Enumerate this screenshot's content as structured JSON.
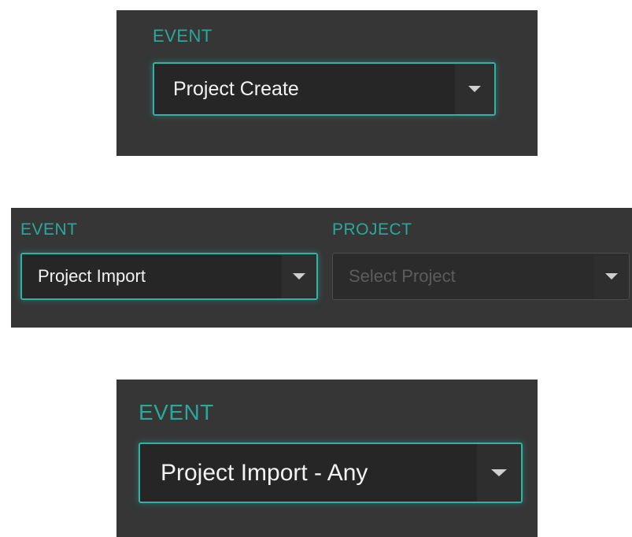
{
  "panel_create": {
    "event_label": "EVENT",
    "event_value": "Project Create",
    "caret_icon": "chevron-down-icon"
  },
  "panel_import": {
    "event_label": "EVENT",
    "event_value": "Project Import",
    "project_label": "PROJECT",
    "project_placeholder": "Select Project",
    "caret_icon": "chevron-down-icon"
  },
  "panel_import_any": {
    "event_label": "EVENT",
    "event_value": "Project Import - Any",
    "caret_icon": "chevron-down-icon"
  },
  "colors": {
    "panel_bg": "#363636",
    "accent": "#2fb3a6",
    "label": "#2aa89b",
    "select_bg": "#262626",
    "text": "#f2f2f2",
    "placeholder": "#5c5c5c"
  }
}
